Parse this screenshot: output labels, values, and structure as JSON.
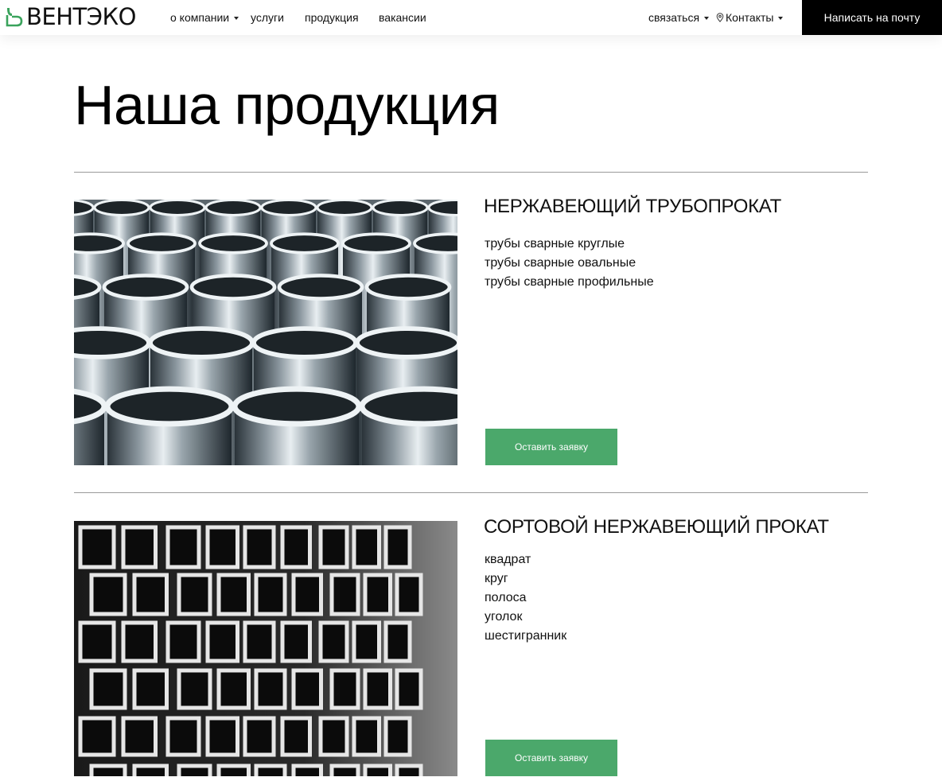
{
  "header": {
    "logo_text": "ВЕНТЭКО",
    "brand_color": "#3aa35c",
    "nav": [
      {
        "label": "о компании",
        "has_dropdown": true
      },
      {
        "label": "услуги",
        "has_dropdown": false
      },
      {
        "label": "продукция",
        "has_dropdown": false
      },
      {
        "label": "вакансии",
        "has_dropdown": false
      }
    ],
    "contact_label": "связаться",
    "contacts_label": "Контакты",
    "mail_button_label": "Написать на почту"
  },
  "main": {
    "title": "Наша продукция",
    "products": [
      {
        "title": "НЕРЖАВЕЮЩИЙ ТРУБОПРОКАТ",
        "items": [
          "трубы сварные круглые",
          "трубы сварные овальные",
          "трубы сварные профильные"
        ],
        "button_label": "Оставить заявку",
        "image_icon": "round-pipes-photo"
      },
      {
        "title": "СОРТОВОЙ НЕРЖАВЕЮЩИЙ ПРОКАТ",
        "items": [
          "квадрат",
          "круг",
          "полоса",
          "уголок",
          "шестигранник"
        ],
        "button_label": "Оставить заявку",
        "image_icon": "square-pipes-photo"
      }
    ]
  },
  "colors": {
    "accent_button": "#4ba86b",
    "mail_button_bg": "#000000",
    "divider": "#9a9a9a"
  }
}
